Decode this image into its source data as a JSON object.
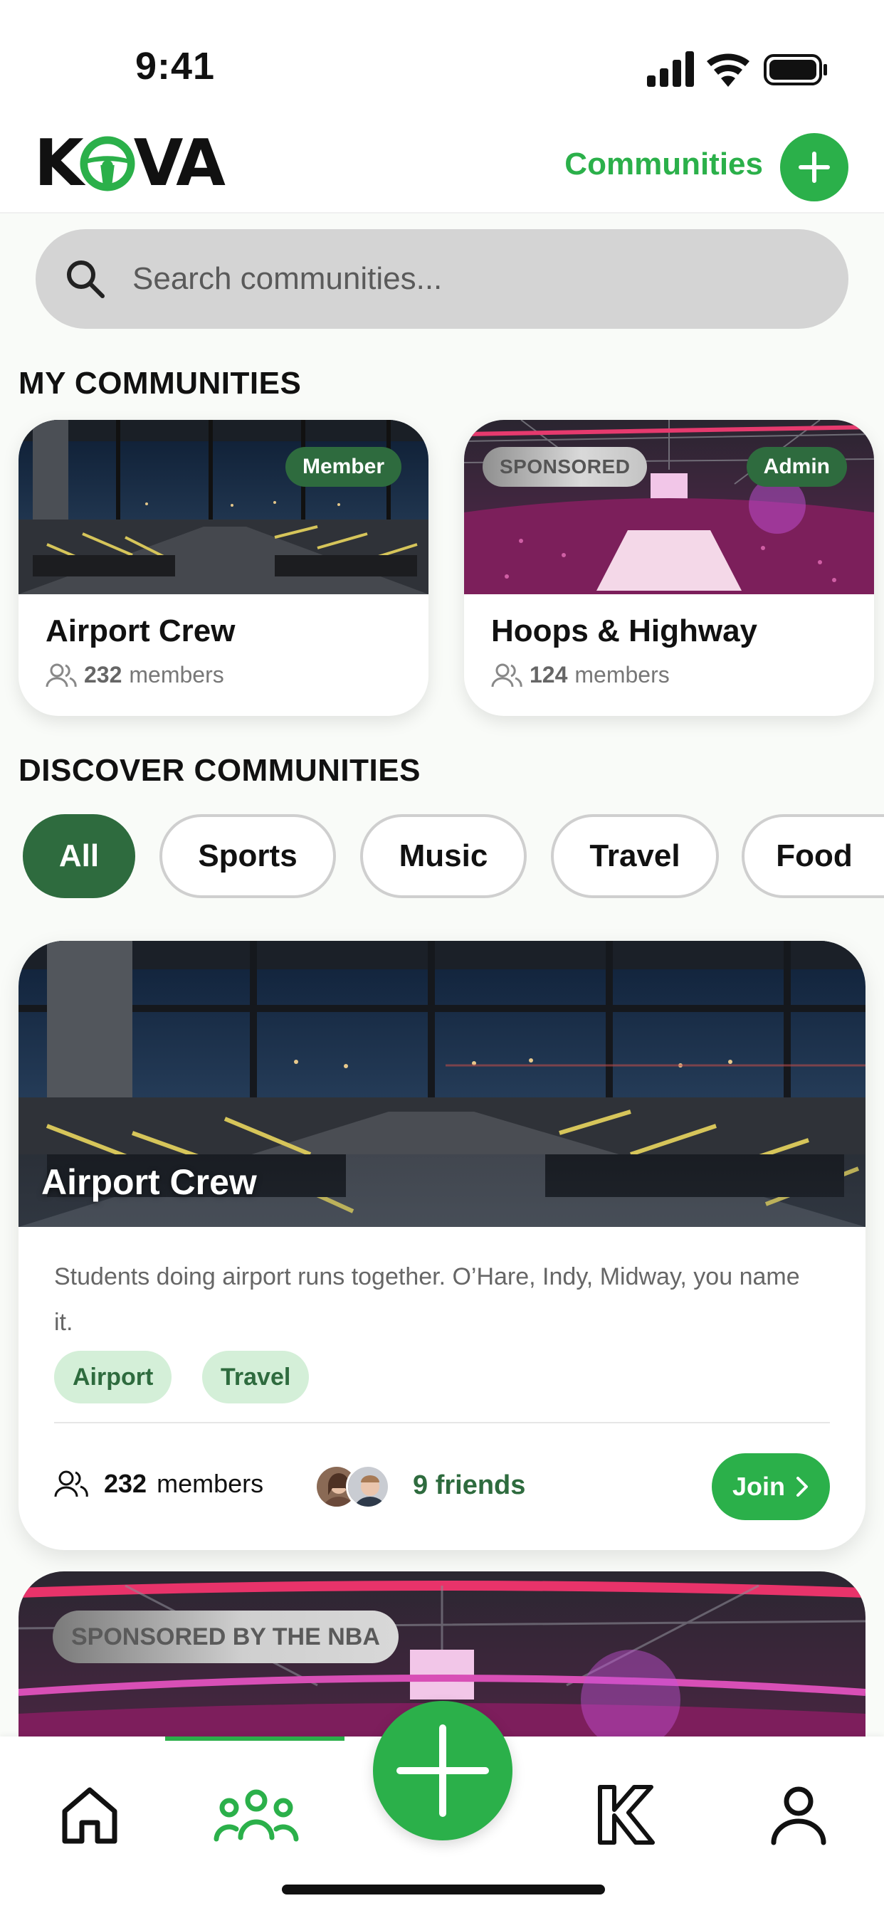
{
  "status_bar": {
    "time": "9:41"
  },
  "header": {
    "logo_text_left": "K",
    "logo_text_right": "VA",
    "title": "Communities"
  },
  "search": {
    "placeholder": "Search communities..."
  },
  "sections": {
    "my": "MY COMMUNITIES",
    "discover": "DISCOVER COMMUNITIES"
  },
  "my_communities": [
    {
      "name": "Airport Crew",
      "members_count": "232",
      "members_label": "members",
      "badge": "Member"
    },
    {
      "name": "Hoops & Highway",
      "members_count": "124",
      "members_label": "members",
      "badge": "Admin",
      "sponsored_label": "SPONSORED"
    }
  ],
  "filters": [
    "All",
    "Sports",
    "Music",
    "Travel",
    "Food"
  ],
  "discover": [
    {
      "name": "Airport Crew",
      "description": "Students doing airport runs together. O’Hare, Indy, Midway, you name it.",
      "tags": [
        "Airport",
        "Travel"
      ],
      "members_count": "232",
      "members_label": "members",
      "friends": "9 friends",
      "join_label": "Join"
    },
    {
      "sponsored_label": "SPONSORED BY THE NBA"
    }
  ],
  "colors": {
    "brand_green": "#2bb04a",
    "dark_green": "#2e6b3e",
    "tag_bg": "#d4efd8"
  },
  "icons": {
    "status": [
      "cellular-signal-icon",
      "wifi-icon",
      "battery-icon"
    ],
    "tabs": [
      "home-icon",
      "communities-icon",
      "add-icon",
      "kova-k-icon",
      "profile-icon"
    ]
  }
}
